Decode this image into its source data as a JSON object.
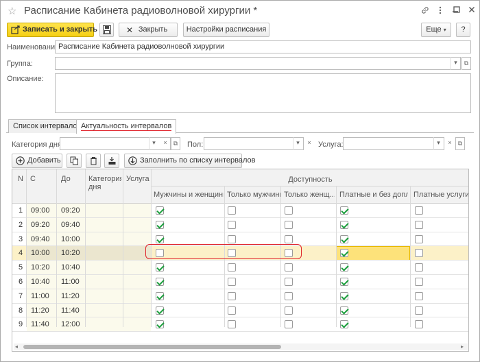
{
  "window": {
    "title": "Расписание Кабинета радиоволновой хирургии *",
    "star": "☆",
    "link_icon": "link-icon",
    "menu_icon": "more-icon",
    "minimize_icon": "minimize-icon",
    "maximize_icon": "maximize-icon",
    "close_icon": "close-icon"
  },
  "toolbar": {
    "save_close": "Записать и закрыть",
    "close": "Закрыть",
    "schedule_settings": "Настройки расписания",
    "more": "Еще",
    "help": "?"
  },
  "form": {
    "name_label": "Наименование:",
    "name_value": "Расписание Кабинета радиоволновой хирургии",
    "group_label": "Группа:",
    "group_value": "",
    "description_label": "Описание:",
    "description_value": ""
  },
  "tabs": [
    {
      "label": "Список интервалов"
    },
    {
      "label": "Актуальность интервалов"
    }
  ],
  "filters": {
    "day_category_label": "Категория дня:",
    "gender_label": "Пол:",
    "service_label": "Услуга:",
    "clear": "×",
    "open": "⧉",
    "dropdown": "▾"
  },
  "grid_toolbar": {
    "add": "Добавить",
    "fill": "Заполнить по списку интервалов"
  },
  "table": {
    "headers": {
      "n": "N",
      "from": "С",
      "to": "До",
      "day_category": "Категория дня",
      "service": "Услуга",
      "availability": "Доступность",
      "men_women": "Мужчины и женщины",
      "men_only": "Только мужчины",
      "women_only": "Только женщ...",
      "paid_free": "Платные и без допл...",
      "paid": "Платные услуги"
    },
    "rows": [
      {
        "n": "1",
        "from": "09:00",
        "to": "09:20",
        "c": [
          true,
          false,
          false,
          true,
          false
        ]
      },
      {
        "n": "2",
        "from": "09:20",
        "to": "09:40",
        "c": [
          true,
          false,
          false,
          true,
          false
        ]
      },
      {
        "n": "3",
        "from": "09:40",
        "to": "10:00",
        "c": [
          true,
          false,
          false,
          true,
          false
        ]
      },
      {
        "n": "4",
        "from": "10:00",
        "to": "10:20",
        "c": [
          false,
          false,
          false,
          true,
          false
        ]
      },
      {
        "n": "5",
        "from": "10:20",
        "to": "10:40",
        "c": [
          true,
          false,
          false,
          true,
          false
        ]
      },
      {
        "n": "6",
        "from": "10:40",
        "to": "11:00",
        "c": [
          true,
          false,
          false,
          true,
          false
        ]
      },
      {
        "n": "7",
        "from": "11:00",
        "to": "11:20",
        "c": [
          true,
          false,
          false,
          true,
          false
        ]
      },
      {
        "n": "8",
        "from": "11:20",
        "to": "11:40",
        "c": [
          true,
          false,
          false,
          true,
          false
        ]
      },
      {
        "n": "9",
        "from": "11:40",
        "to": "12:00",
        "c": [
          true,
          false,
          false,
          true,
          false
        ]
      }
    ],
    "selected_row": 4
  },
  "colors": {
    "accent_yellow": "#f5cf14",
    "check_green": "#1a9e3b",
    "highlight_red": "#e0242c",
    "selected_row": "#fcf1c8",
    "time_cell_bg": "#fbfaec"
  }
}
